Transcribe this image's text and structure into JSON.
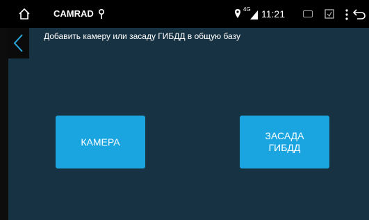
{
  "status_bar": {
    "app_name": "CAMRAD",
    "network": "4G",
    "time": "11:21"
  },
  "header": {
    "subtitle": "Добавить камеру или засаду ГИБДД в общую базу"
  },
  "buttons": {
    "camera": "КАМЕРА",
    "ambush_line1": "ЗАСАДА",
    "ambush_line2": "ГИБДД"
  },
  "colors": {
    "background": "#173242",
    "accent": "#1aa4e0",
    "status_bar": "#000000"
  },
  "icons": [
    "home-icon",
    "location-icon",
    "location-pin-icon",
    "signal-icon",
    "screen-icon",
    "screenshot-icon",
    "menu-dots-icon",
    "nav-back-icon",
    "chevron-left-icon"
  ]
}
